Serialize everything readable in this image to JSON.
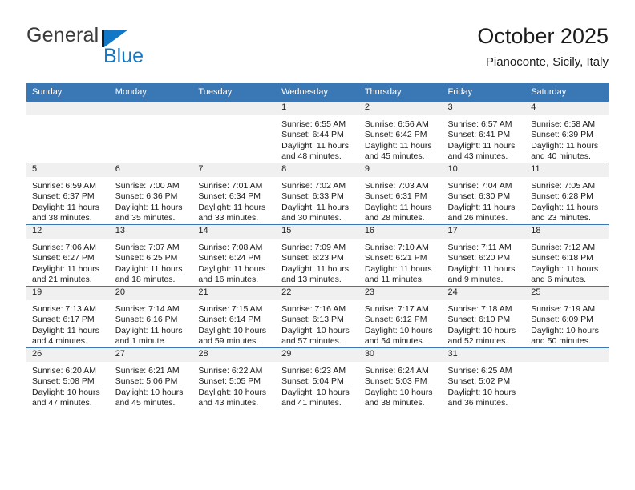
{
  "brand": {
    "name_top": "General",
    "name_bottom": "Blue"
  },
  "header": {
    "title": "October 2025",
    "location": "Pianoconte, Sicily, Italy"
  },
  "calendar": {
    "weekday_headers": [
      "Sunday",
      "Monday",
      "Tuesday",
      "Wednesday",
      "Thursday",
      "Friday",
      "Saturday"
    ],
    "accent_color": "#3a78b5",
    "daynum_band_color": "#f0f0f0",
    "weeks": [
      [
        {
          "day": "",
          "sunrise": "",
          "sunset": "",
          "daylight_line1": "",
          "daylight_line2": "",
          "empty": true
        },
        {
          "day": "",
          "sunrise": "",
          "sunset": "",
          "daylight_line1": "",
          "daylight_line2": "",
          "empty": true
        },
        {
          "day": "",
          "sunrise": "",
          "sunset": "",
          "daylight_line1": "",
          "daylight_line2": "",
          "empty": true
        },
        {
          "day": "1",
          "sunrise": "Sunrise: 6:55 AM",
          "sunset": "Sunset: 6:44 PM",
          "daylight_line1": "Daylight: 11 hours",
          "daylight_line2": "and 48 minutes."
        },
        {
          "day": "2",
          "sunrise": "Sunrise: 6:56 AM",
          "sunset": "Sunset: 6:42 PM",
          "daylight_line1": "Daylight: 11 hours",
          "daylight_line2": "and 45 minutes."
        },
        {
          "day": "3",
          "sunrise": "Sunrise: 6:57 AM",
          "sunset": "Sunset: 6:41 PM",
          "daylight_line1": "Daylight: 11 hours",
          "daylight_line2": "and 43 minutes."
        },
        {
          "day": "4",
          "sunrise": "Sunrise: 6:58 AM",
          "sunset": "Sunset: 6:39 PM",
          "daylight_line1": "Daylight: 11 hours",
          "daylight_line2": "and 40 minutes."
        }
      ],
      [
        {
          "day": "5",
          "sunrise": "Sunrise: 6:59 AM",
          "sunset": "Sunset: 6:37 PM",
          "daylight_line1": "Daylight: 11 hours",
          "daylight_line2": "and 38 minutes."
        },
        {
          "day": "6",
          "sunrise": "Sunrise: 7:00 AM",
          "sunset": "Sunset: 6:36 PM",
          "daylight_line1": "Daylight: 11 hours",
          "daylight_line2": "and 35 minutes."
        },
        {
          "day": "7",
          "sunrise": "Sunrise: 7:01 AM",
          "sunset": "Sunset: 6:34 PM",
          "daylight_line1": "Daylight: 11 hours",
          "daylight_line2": "and 33 minutes."
        },
        {
          "day": "8",
          "sunrise": "Sunrise: 7:02 AM",
          "sunset": "Sunset: 6:33 PM",
          "daylight_line1": "Daylight: 11 hours",
          "daylight_line2": "and 30 minutes."
        },
        {
          "day": "9",
          "sunrise": "Sunrise: 7:03 AM",
          "sunset": "Sunset: 6:31 PM",
          "daylight_line1": "Daylight: 11 hours",
          "daylight_line2": "and 28 minutes."
        },
        {
          "day": "10",
          "sunrise": "Sunrise: 7:04 AM",
          "sunset": "Sunset: 6:30 PM",
          "daylight_line1": "Daylight: 11 hours",
          "daylight_line2": "and 26 minutes."
        },
        {
          "day": "11",
          "sunrise": "Sunrise: 7:05 AM",
          "sunset": "Sunset: 6:28 PM",
          "daylight_line1": "Daylight: 11 hours",
          "daylight_line2": "and 23 minutes."
        }
      ],
      [
        {
          "day": "12",
          "sunrise": "Sunrise: 7:06 AM",
          "sunset": "Sunset: 6:27 PM",
          "daylight_line1": "Daylight: 11 hours",
          "daylight_line2": "and 21 minutes."
        },
        {
          "day": "13",
          "sunrise": "Sunrise: 7:07 AM",
          "sunset": "Sunset: 6:25 PM",
          "daylight_line1": "Daylight: 11 hours",
          "daylight_line2": "and 18 minutes."
        },
        {
          "day": "14",
          "sunrise": "Sunrise: 7:08 AM",
          "sunset": "Sunset: 6:24 PM",
          "daylight_line1": "Daylight: 11 hours",
          "daylight_line2": "and 16 minutes."
        },
        {
          "day": "15",
          "sunrise": "Sunrise: 7:09 AM",
          "sunset": "Sunset: 6:23 PM",
          "daylight_line1": "Daylight: 11 hours",
          "daylight_line2": "and 13 minutes."
        },
        {
          "day": "16",
          "sunrise": "Sunrise: 7:10 AM",
          "sunset": "Sunset: 6:21 PM",
          "daylight_line1": "Daylight: 11 hours",
          "daylight_line2": "and 11 minutes."
        },
        {
          "day": "17",
          "sunrise": "Sunrise: 7:11 AM",
          "sunset": "Sunset: 6:20 PM",
          "daylight_line1": "Daylight: 11 hours",
          "daylight_line2": "and 9 minutes."
        },
        {
          "day": "18",
          "sunrise": "Sunrise: 7:12 AM",
          "sunset": "Sunset: 6:18 PM",
          "daylight_line1": "Daylight: 11 hours",
          "daylight_line2": "and 6 minutes."
        }
      ],
      [
        {
          "day": "19",
          "sunrise": "Sunrise: 7:13 AM",
          "sunset": "Sunset: 6:17 PM",
          "daylight_line1": "Daylight: 11 hours",
          "daylight_line2": "and 4 minutes."
        },
        {
          "day": "20",
          "sunrise": "Sunrise: 7:14 AM",
          "sunset": "Sunset: 6:16 PM",
          "daylight_line1": "Daylight: 11 hours",
          "daylight_line2": "and 1 minute."
        },
        {
          "day": "21",
          "sunrise": "Sunrise: 7:15 AM",
          "sunset": "Sunset: 6:14 PM",
          "daylight_line1": "Daylight: 10 hours",
          "daylight_line2": "and 59 minutes."
        },
        {
          "day": "22",
          "sunrise": "Sunrise: 7:16 AM",
          "sunset": "Sunset: 6:13 PM",
          "daylight_line1": "Daylight: 10 hours",
          "daylight_line2": "and 57 minutes."
        },
        {
          "day": "23",
          "sunrise": "Sunrise: 7:17 AM",
          "sunset": "Sunset: 6:12 PM",
          "daylight_line1": "Daylight: 10 hours",
          "daylight_line2": "and 54 minutes."
        },
        {
          "day": "24",
          "sunrise": "Sunrise: 7:18 AM",
          "sunset": "Sunset: 6:10 PM",
          "daylight_line1": "Daylight: 10 hours",
          "daylight_line2": "and 52 minutes."
        },
        {
          "day": "25",
          "sunrise": "Sunrise: 7:19 AM",
          "sunset": "Sunset: 6:09 PM",
          "daylight_line1": "Daylight: 10 hours",
          "daylight_line2": "and 50 minutes."
        }
      ],
      [
        {
          "day": "26",
          "sunrise": "Sunrise: 6:20 AM",
          "sunset": "Sunset: 5:08 PM",
          "daylight_line1": "Daylight: 10 hours",
          "daylight_line2": "and 47 minutes."
        },
        {
          "day": "27",
          "sunrise": "Sunrise: 6:21 AM",
          "sunset": "Sunset: 5:06 PM",
          "daylight_line1": "Daylight: 10 hours",
          "daylight_line2": "and 45 minutes."
        },
        {
          "day": "28",
          "sunrise": "Sunrise: 6:22 AM",
          "sunset": "Sunset: 5:05 PM",
          "daylight_line1": "Daylight: 10 hours",
          "daylight_line2": "and 43 minutes."
        },
        {
          "day": "29",
          "sunrise": "Sunrise: 6:23 AM",
          "sunset": "Sunset: 5:04 PM",
          "daylight_line1": "Daylight: 10 hours",
          "daylight_line2": "and 41 minutes."
        },
        {
          "day": "30",
          "sunrise": "Sunrise: 6:24 AM",
          "sunset": "Sunset: 5:03 PM",
          "daylight_line1": "Daylight: 10 hours",
          "daylight_line2": "and 38 minutes."
        },
        {
          "day": "31",
          "sunrise": "Sunrise: 6:25 AM",
          "sunset": "Sunset: 5:02 PM",
          "daylight_line1": "Daylight: 10 hours",
          "daylight_line2": "and 36 minutes."
        },
        {
          "day": "",
          "sunrise": "",
          "sunset": "",
          "daylight_line1": "",
          "daylight_line2": "",
          "empty": true
        }
      ]
    ]
  }
}
